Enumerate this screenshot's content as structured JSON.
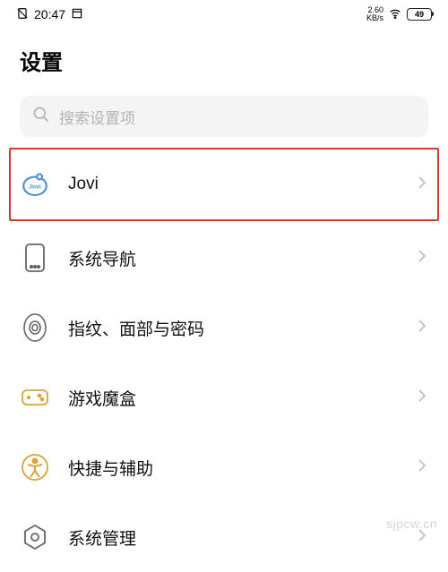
{
  "status_bar": {
    "time": "20:47",
    "net_speed_value": "2.60",
    "net_speed_unit": "KB/s",
    "battery_level": "49"
  },
  "page": {
    "title": "设置"
  },
  "search": {
    "placeholder": "搜索设置项"
  },
  "settings_items": [
    {
      "id": "jovi",
      "label": "Jovi",
      "highlighted": true
    },
    {
      "id": "system-nav",
      "label": "系统导航",
      "highlighted": false
    },
    {
      "id": "biometrics",
      "label": "指纹、面部与密码",
      "highlighted": false
    },
    {
      "id": "game-box",
      "label": "游戏魔盒",
      "highlighted": false
    },
    {
      "id": "accessibility",
      "label": "快捷与辅助",
      "highlighted": false
    },
    {
      "id": "system-management",
      "label": "系统管理",
      "highlighted": false
    }
  ],
  "watermark": "sjpcw.cn"
}
